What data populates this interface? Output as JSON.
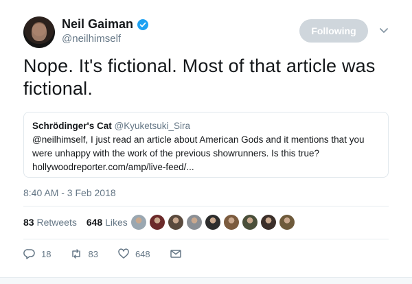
{
  "author": {
    "name": "Neil Gaiman",
    "handle": "@neilhimself",
    "verified": true
  },
  "follow_button": {
    "label": "Following"
  },
  "tweet": {
    "text": "Nope. It's fictional. Most of that article was fictional.",
    "timestamp": "8:40 AM - 3 Feb 2018"
  },
  "quoted": {
    "name": "Schrödinger's Cat",
    "handle": "@Kyuketsuki_Sira",
    "body": "@neilhimself, I just read an article about American Gods and it mentions that you were unhappy with the work of the previous showrunners. Is this true? hollywoodreporter.com/amp/live-feed/..."
  },
  "stats": {
    "retweets_count": "83",
    "retweets_label": "Retweets",
    "likes_count": "648",
    "likes_label": "Likes"
  },
  "likers": [
    {
      "icon": "user-avatar",
      "color": "#9aa7b1"
    },
    {
      "icon": "user-avatar",
      "color": "#6b2a2a"
    },
    {
      "icon": "user-avatar",
      "color": "#5a4a3d"
    },
    {
      "icon": "user-avatar",
      "color": "#8a8f95"
    },
    {
      "icon": "user-avatar",
      "color": "#2d2d2d"
    },
    {
      "icon": "user-avatar",
      "color": "#7b5b3e"
    },
    {
      "icon": "user-avatar",
      "color": "#4a4f3a"
    },
    {
      "icon": "user-avatar",
      "color": "#3b2f2a"
    },
    {
      "icon": "user-avatar",
      "color": "#6e5a3b"
    }
  ],
  "actions": {
    "reply_count": "18",
    "retweet_count": "83",
    "like_count": "648"
  },
  "colors": {
    "verified_blue": "#1da1f2",
    "follow_bg": "#cfd6dc",
    "muted_text": "#657786"
  }
}
